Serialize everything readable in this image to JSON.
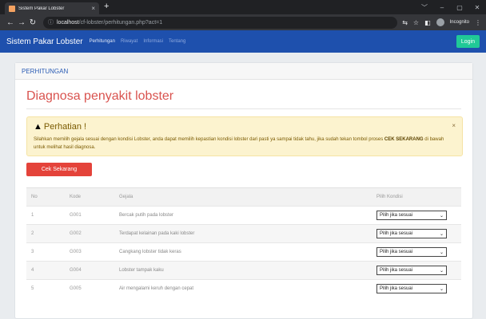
{
  "browser": {
    "tab_title": "Sistem Pakar Lobster",
    "tab_close": "×",
    "new_tab": "+",
    "url_host": "localhost",
    "url_path": "/cf-lobster/perhitungan.php?act=1",
    "incognito_label": "Incognito",
    "window_controls": [
      "﹀",
      "–",
      "▢",
      "✕"
    ]
  },
  "navbar": {
    "brand": "Sistem Pakar Lobster",
    "links": [
      "Perhitungan",
      "Riwayat",
      "Informasi",
      "Tentang"
    ],
    "active_link": "Perhitungan",
    "login_label": "Login"
  },
  "card": {
    "header": "PERHITUNGAN",
    "title": "Diagnosa penyakit lobster"
  },
  "alert": {
    "heading": "Perhatian !",
    "close": "×",
    "text_before": "Silahkan memilih gejala sesuai dengan kondisi Lobster, anda dapat memilih kepastian kondisi lobster dari pasti ya sampai tidak tahu, jika sudah tekan tombol proses ",
    "text_bold": "CEK SEKARANG",
    "text_after": " di bawah untuk melihat hasil diagnosa."
  },
  "button": {
    "cek_label": "Cek Sekarang"
  },
  "table": {
    "headers": [
      "No",
      "Kode",
      "Gejala",
      "Pilih Kondisi"
    ],
    "rows": [
      {
        "no": "1",
        "kode": "G001",
        "gejala": "Bercak putih pada lobster",
        "kondisi": "Pilih jika sesuai"
      },
      {
        "no": "2",
        "kode": "G002",
        "gejala": "Terdapat kelainan pada kaki lobster",
        "kondisi": "Pilih jika sesuai"
      },
      {
        "no": "3",
        "kode": "G003",
        "gejala": "Cangkang lobster tidak keras",
        "kondisi": "Pilih jika sesuai"
      },
      {
        "no": "4",
        "kode": "G004",
        "gejala": "Lobster tampak kaku",
        "kondisi": "Pilih jika sesuai"
      },
      {
        "no": "5",
        "kode": "G005",
        "gejala": "Air mengalami keruh dengan cepat",
        "kondisi": "Pilih jika sesuai"
      }
    ]
  }
}
